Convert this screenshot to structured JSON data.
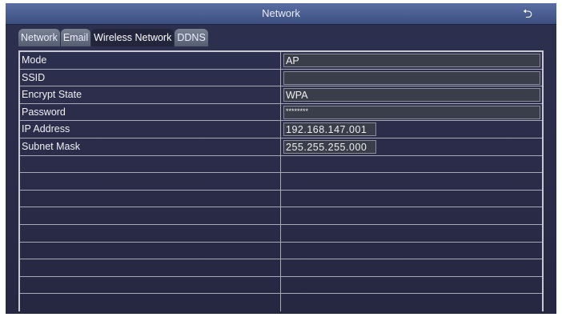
{
  "window": {
    "title": "Network",
    "back_icon": "return-icon"
  },
  "tabs": [
    {
      "label": "Network"
    },
    {
      "label": "Email"
    },
    {
      "label": "Wireless Network",
      "active": true
    },
    {
      "label": "DDNS"
    }
  ],
  "fields": [
    {
      "label": "Mode",
      "value": "AP"
    },
    {
      "label": "SSID",
      "value": ""
    },
    {
      "label": "Encrypt State",
      "value": "WPA"
    },
    {
      "label": "Password",
      "value": "********"
    },
    {
      "label": "IP Address",
      "value": "192.168.147.001"
    },
    {
      "label": "Subnet Mask",
      "value": "255.255.255.000"
    }
  ]
}
